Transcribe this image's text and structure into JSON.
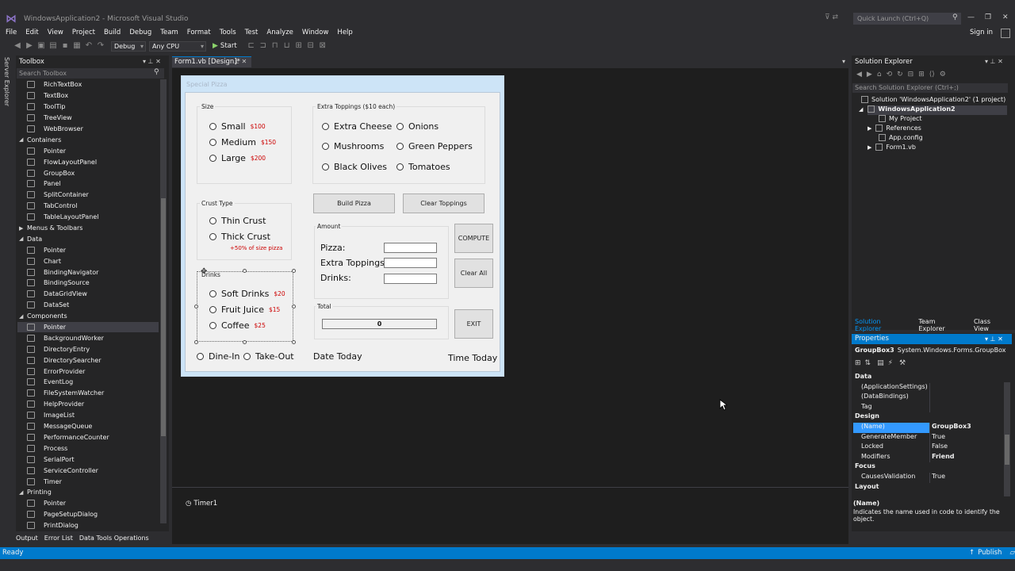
{
  "window": {
    "title": "WindowsApplication2 - Microsoft Visual Studio",
    "quick_launch_placeholder": "Quick Launch (Ctrl+Q)",
    "sign_in": "Sign in"
  },
  "menu": [
    "File",
    "Edit",
    "View",
    "Project",
    "Build",
    "Debug",
    "Team",
    "Format",
    "Tools",
    "Test",
    "Analyze",
    "Window",
    "Help"
  ],
  "toolbar": {
    "config": "Debug",
    "platform": "Any CPU",
    "start": "Start"
  },
  "server_explorer": "Server Explorer",
  "toolbox": {
    "title": "Toolbox",
    "search_placeholder": "Search Toolbox",
    "items": [
      {
        "label": "RichTextBox",
        "type": "item"
      },
      {
        "label": "TextBox",
        "type": "item"
      },
      {
        "label": "ToolTip",
        "type": "item"
      },
      {
        "label": "TreeView",
        "type": "item"
      },
      {
        "label": "WebBrowser",
        "type": "item"
      },
      {
        "label": "Containers",
        "type": "cat",
        "expanded": true
      },
      {
        "label": "Pointer",
        "type": "item"
      },
      {
        "label": "FlowLayoutPanel",
        "type": "item"
      },
      {
        "label": "GroupBox",
        "type": "item"
      },
      {
        "label": "Panel",
        "type": "item"
      },
      {
        "label": "SplitContainer",
        "type": "item"
      },
      {
        "label": "TabControl",
        "type": "item"
      },
      {
        "label": "TableLayoutPanel",
        "type": "item"
      },
      {
        "label": "Menus & Toolbars",
        "type": "cat",
        "expanded": false
      },
      {
        "label": "Data",
        "type": "cat",
        "expanded": true
      },
      {
        "label": "Pointer",
        "type": "item"
      },
      {
        "label": "Chart",
        "type": "item"
      },
      {
        "label": "BindingNavigator",
        "type": "item"
      },
      {
        "label": "BindingSource",
        "type": "item"
      },
      {
        "label": "DataGridView",
        "type": "item"
      },
      {
        "label": "DataSet",
        "type": "item"
      },
      {
        "label": "Components",
        "type": "cat",
        "expanded": true
      },
      {
        "label": "Pointer",
        "type": "item",
        "selected": true
      },
      {
        "label": "BackgroundWorker",
        "type": "item"
      },
      {
        "label": "DirectoryEntry",
        "type": "item"
      },
      {
        "label": "DirectorySearcher",
        "type": "item"
      },
      {
        "label": "ErrorProvider",
        "type": "item"
      },
      {
        "label": "EventLog",
        "type": "item"
      },
      {
        "label": "FileSystemWatcher",
        "type": "item"
      },
      {
        "label": "HelpProvider",
        "type": "item"
      },
      {
        "label": "ImageList",
        "type": "item"
      },
      {
        "label": "MessageQueue",
        "type": "item"
      },
      {
        "label": "PerformanceCounter",
        "type": "item"
      },
      {
        "label": "Process",
        "type": "item"
      },
      {
        "label": "SerialPort",
        "type": "item"
      },
      {
        "label": "ServiceController",
        "type": "item"
      },
      {
        "label": "Timer",
        "type": "item"
      },
      {
        "label": "Printing",
        "type": "cat",
        "expanded": true
      },
      {
        "label": "Pointer",
        "type": "item"
      },
      {
        "label": "PageSetupDialog",
        "type": "item"
      },
      {
        "label": "PrintDialog",
        "type": "item"
      }
    ]
  },
  "doc_tab": "Form1.vb [Design]*",
  "form": {
    "title": "Special Pizza",
    "size_group": "Size",
    "size_options": [
      {
        "label": "Small",
        "price": "$100"
      },
      {
        "label": "Medium",
        "price": "$150"
      },
      {
        "label": "Large",
        "price": "$200"
      }
    ],
    "toppings_group": "Extra Toppings ($10 each)",
    "toppings_left": [
      "Extra Cheese",
      "Mushrooms",
      "Black Olives"
    ],
    "toppings_right": [
      "Onions",
      "Green Peppers",
      "Tomatoes"
    ],
    "build_pizza": "Build Pizza",
    "clear_toppings": "Clear Toppings",
    "crust_group": "Crust Type",
    "crust_options": [
      "Thin Crust",
      "Thick Crust"
    ],
    "crust_note": "+50% of size pizza",
    "amount_group": "Amount",
    "amount_labels": [
      "Pizza:",
      "Extra Toppings:",
      "Drinks:"
    ],
    "compute": "COMPUTE",
    "clear_all": "Clear All",
    "drinks_group": "Drinks",
    "drink_options": [
      {
        "label": "Soft Drinks",
        "price": "$20"
      },
      {
        "label": "Fruit Juice",
        "price": "$15"
      },
      {
        "label": "Coffee",
        "price": "$25"
      }
    ],
    "total_group": "Total",
    "total_value": "0",
    "exit": "EXIT",
    "dine_in": "Dine-In",
    "take_out": "Take-Out",
    "date_today": "Date Today",
    "time_today": "Time Today"
  },
  "tray": {
    "timer": "Timer1"
  },
  "solution_explorer": {
    "title": "Solution Explorer",
    "search_placeholder": "Search Solution Explorer (Ctrl+;)",
    "solution": "Solution 'WindowsApplication2' (1 project)",
    "project": "WindowsApplication2",
    "nodes": [
      "My Project",
      "References",
      "App.config",
      "Form1.vb"
    ],
    "tabs": [
      "Solution Explorer",
      "Team Explorer",
      "Class View"
    ]
  },
  "properties": {
    "title": "Properties",
    "object": "GroupBox3",
    "object_type": "System.Windows.Forms.GroupBox",
    "rows": [
      {
        "name": "Data",
        "cat": true
      },
      {
        "name": "(ApplicationSettings)",
        "value": ""
      },
      {
        "name": "(DataBindings)",
        "value": ""
      },
      {
        "name": "Tag",
        "value": ""
      },
      {
        "name": "Design",
        "cat": true
      },
      {
        "name": "(Name)",
        "value": "GroupBox3",
        "selected": true
      },
      {
        "name": "GenerateMember",
        "value": "True"
      },
      {
        "name": "Locked",
        "value": "False"
      },
      {
        "name": "Modifiers",
        "value": "Friend"
      },
      {
        "name": "Focus",
        "cat": true
      },
      {
        "name": "CausesValidation",
        "value": "True"
      },
      {
        "name": "Layout",
        "cat": true
      }
    ],
    "desc_title": "(Name)",
    "desc_text": "Indicates the name used in code to identify the object."
  },
  "bottom_tabs": [
    "Output",
    "Error List",
    "Data Tools Operations"
  ],
  "status": {
    "left": "Ready",
    "publish": "Publish"
  }
}
